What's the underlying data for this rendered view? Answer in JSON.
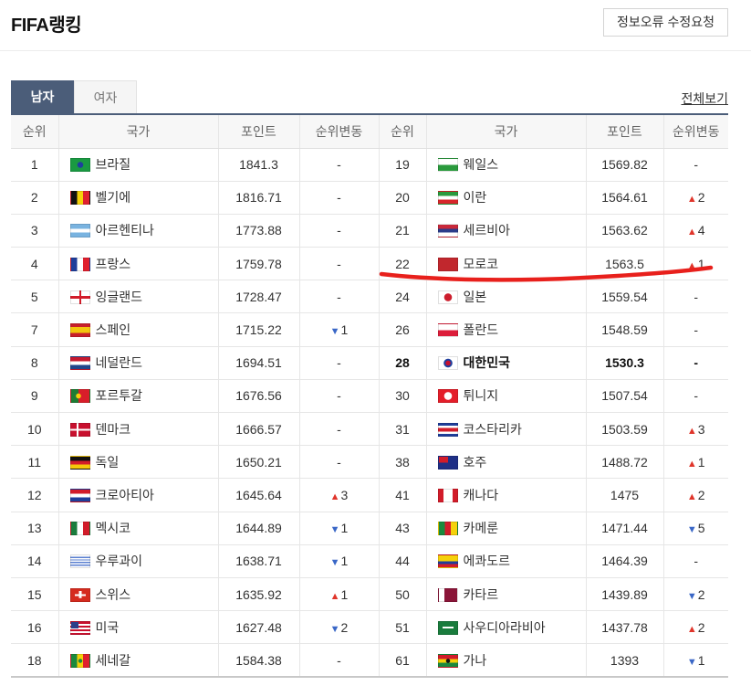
{
  "header": {
    "title": "FIFA랭킹",
    "report_button": "정보오류 수정요청"
  },
  "tabs": [
    {
      "label": "남자",
      "active": true
    },
    {
      "label": "여자",
      "active": false
    }
  ],
  "view_all": "전체보기",
  "columns": [
    "순위",
    "국가",
    "포인트",
    "순위변동",
    "순위",
    "국가",
    "포인트",
    "순위변동"
  ],
  "colors": {
    "header_bar": "#4b5d79",
    "up": "#e0352b",
    "down": "#3a67c7",
    "annotation": "#e8201c"
  },
  "rows": [
    {
      "left": {
        "rank": "1",
        "country": "브라질",
        "flag": "brazil",
        "points": "1841.3",
        "change": "-"
      },
      "right": {
        "rank": "19",
        "country": "웨일스",
        "flag": "wales",
        "points": "1569.82",
        "change": "-"
      }
    },
    {
      "left": {
        "rank": "2",
        "country": "벨기에",
        "flag": "belgium",
        "points": "1816.71",
        "change": "-"
      },
      "right": {
        "rank": "20",
        "country": "이란",
        "flag": "iran",
        "points": "1564.61",
        "change": "▲2"
      }
    },
    {
      "left": {
        "rank": "3",
        "country": "아르헨티나",
        "flag": "argentina",
        "points": "1773.88",
        "change": "-"
      },
      "right": {
        "rank": "21",
        "country": "세르비아",
        "flag": "serbia",
        "points": "1563.62",
        "change": "▲4"
      }
    },
    {
      "left": {
        "rank": "4",
        "country": "프랑스",
        "flag": "france",
        "points": "1759.78",
        "change": "-"
      },
      "right": {
        "rank": "22",
        "country": "모로코",
        "flag": "morocco",
        "points": "1563.5",
        "change": "▲1"
      }
    },
    {
      "left": {
        "rank": "5",
        "country": "잉글랜드",
        "flag": "england",
        "points": "1728.47",
        "change": "-"
      },
      "right": {
        "rank": "24",
        "country": "일본",
        "flag": "japan",
        "points": "1559.54",
        "change": "-"
      }
    },
    {
      "left": {
        "rank": "7",
        "country": "스페인",
        "flag": "spain",
        "points": "1715.22",
        "change": "▼1"
      },
      "right": {
        "rank": "26",
        "country": "폴란드",
        "flag": "poland",
        "points": "1548.59",
        "change": "-"
      }
    },
    {
      "left": {
        "rank": "8",
        "country": "네덜란드",
        "flag": "netherlands",
        "points": "1694.51",
        "change": "-"
      },
      "right": {
        "rank": "28",
        "country": "대한민국",
        "flag": "korea",
        "points": "1530.3",
        "change": "-",
        "bold": true
      }
    },
    {
      "left": {
        "rank": "9",
        "country": "포르투갈",
        "flag": "portugal",
        "points": "1676.56",
        "change": "-"
      },
      "right": {
        "rank": "30",
        "country": "튀니지",
        "flag": "tunisia",
        "points": "1507.54",
        "change": "-"
      }
    },
    {
      "left": {
        "rank": "10",
        "country": "덴마크",
        "flag": "denmark",
        "points": "1666.57",
        "change": "-"
      },
      "right": {
        "rank": "31",
        "country": "코스타리카",
        "flag": "costarica",
        "points": "1503.59",
        "change": "▲3"
      }
    },
    {
      "left": {
        "rank": "11",
        "country": "독일",
        "flag": "germany",
        "points": "1650.21",
        "change": "-"
      },
      "right": {
        "rank": "38",
        "country": "호주",
        "flag": "australia",
        "points": "1488.72",
        "change": "▲1"
      }
    },
    {
      "left": {
        "rank": "12",
        "country": "크로아티아",
        "flag": "croatia",
        "points": "1645.64",
        "change": "▲3"
      },
      "right": {
        "rank": "41",
        "country": "캐나다",
        "flag": "canada",
        "points": "1475",
        "change": "▲2"
      }
    },
    {
      "left": {
        "rank": "13",
        "country": "멕시코",
        "flag": "mexico",
        "points": "1644.89",
        "change": "▼1"
      },
      "right": {
        "rank": "43",
        "country": "카메룬",
        "flag": "cameroon",
        "points": "1471.44",
        "change": "▼5"
      }
    },
    {
      "left": {
        "rank": "14",
        "country": "우루과이",
        "flag": "uruguay",
        "points": "1638.71",
        "change": "▼1"
      },
      "right": {
        "rank": "44",
        "country": "에콰도르",
        "flag": "ecuador",
        "points": "1464.39",
        "change": "-"
      }
    },
    {
      "left": {
        "rank": "15",
        "country": "스위스",
        "flag": "switzerland",
        "points": "1635.92",
        "change": "▲1"
      },
      "right": {
        "rank": "50",
        "country": "카타르",
        "flag": "qatar",
        "points": "1439.89",
        "change": "▼2"
      }
    },
    {
      "left": {
        "rank": "16",
        "country": "미국",
        "flag": "usa",
        "points": "1627.48",
        "change": "▼2"
      },
      "right": {
        "rank": "51",
        "country": "사우디아라비아",
        "flag": "saudi",
        "points": "1437.78",
        "change": "▲2"
      }
    },
    {
      "left": {
        "rank": "18",
        "country": "세네갈",
        "flag": "senegal",
        "points": "1584.38",
        "change": "-"
      },
      "right": {
        "rank": "61",
        "country": "가나",
        "flag": "ghana",
        "points": "1393",
        "change": "▼1"
      }
    }
  ]
}
